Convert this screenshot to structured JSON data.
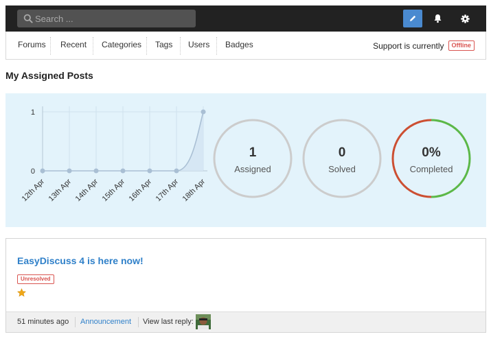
{
  "search": {
    "placeholder": "Search ..."
  },
  "toolbar": {
    "compose_icon": "pencil-icon",
    "notify_icon": "bell-icon",
    "settings_icon": "gear-icon",
    "accent_color": "#4a8ad0"
  },
  "nav": {
    "items": [
      {
        "label": "Forums"
      },
      {
        "label": "Recent"
      },
      {
        "label": "Categories"
      },
      {
        "label": "Tags"
      },
      {
        "label": "Users"
      },
      {
        "label": "Badges"
      }
    ],
    "support_text": "Support is currently",
    "support_status": "Offline"
  },
  "page": {
    "title": "My Assigned Posts"
  },
  "stats": {
    "assigned": {
      "value": "1",
      "label": "Assigned"
    },
    "solved": {
      "value": "0",
      "label": "Solved"
    },
    "completed": {
      "value": "0%",
      "label": "Completed",
      "percent": 0
    }
  },
  "chart_data": {
    "type": "area",
    "categories": [
      "12th Apr",
      "13th Apr",
      "14th Apr",
      "15th Apr",
      "16th Apr",
      "17th Apr",
      "18th Apr"
    ],
    "values": [
      0,
      0,
      0,
      0,
      0,
      0,
      1
    ],
    "ylim": [
      0,
      1
    ],
    "yticks": [
      "0",
      "1"
    ],
    "grid": true,
    "line_color": "#a9bfd4",
    "fill_color": "#d4e6f3"
  },
  "post": {
    "title": "EasyDiscuss 4 is here now!",
    "status": "Unresolved",
    "featured_icon": "star-icon",
    "time": "51 minutes ago",
    "category": "Announcement",
    "last_reply_label": "View last reply:"
  }
}
